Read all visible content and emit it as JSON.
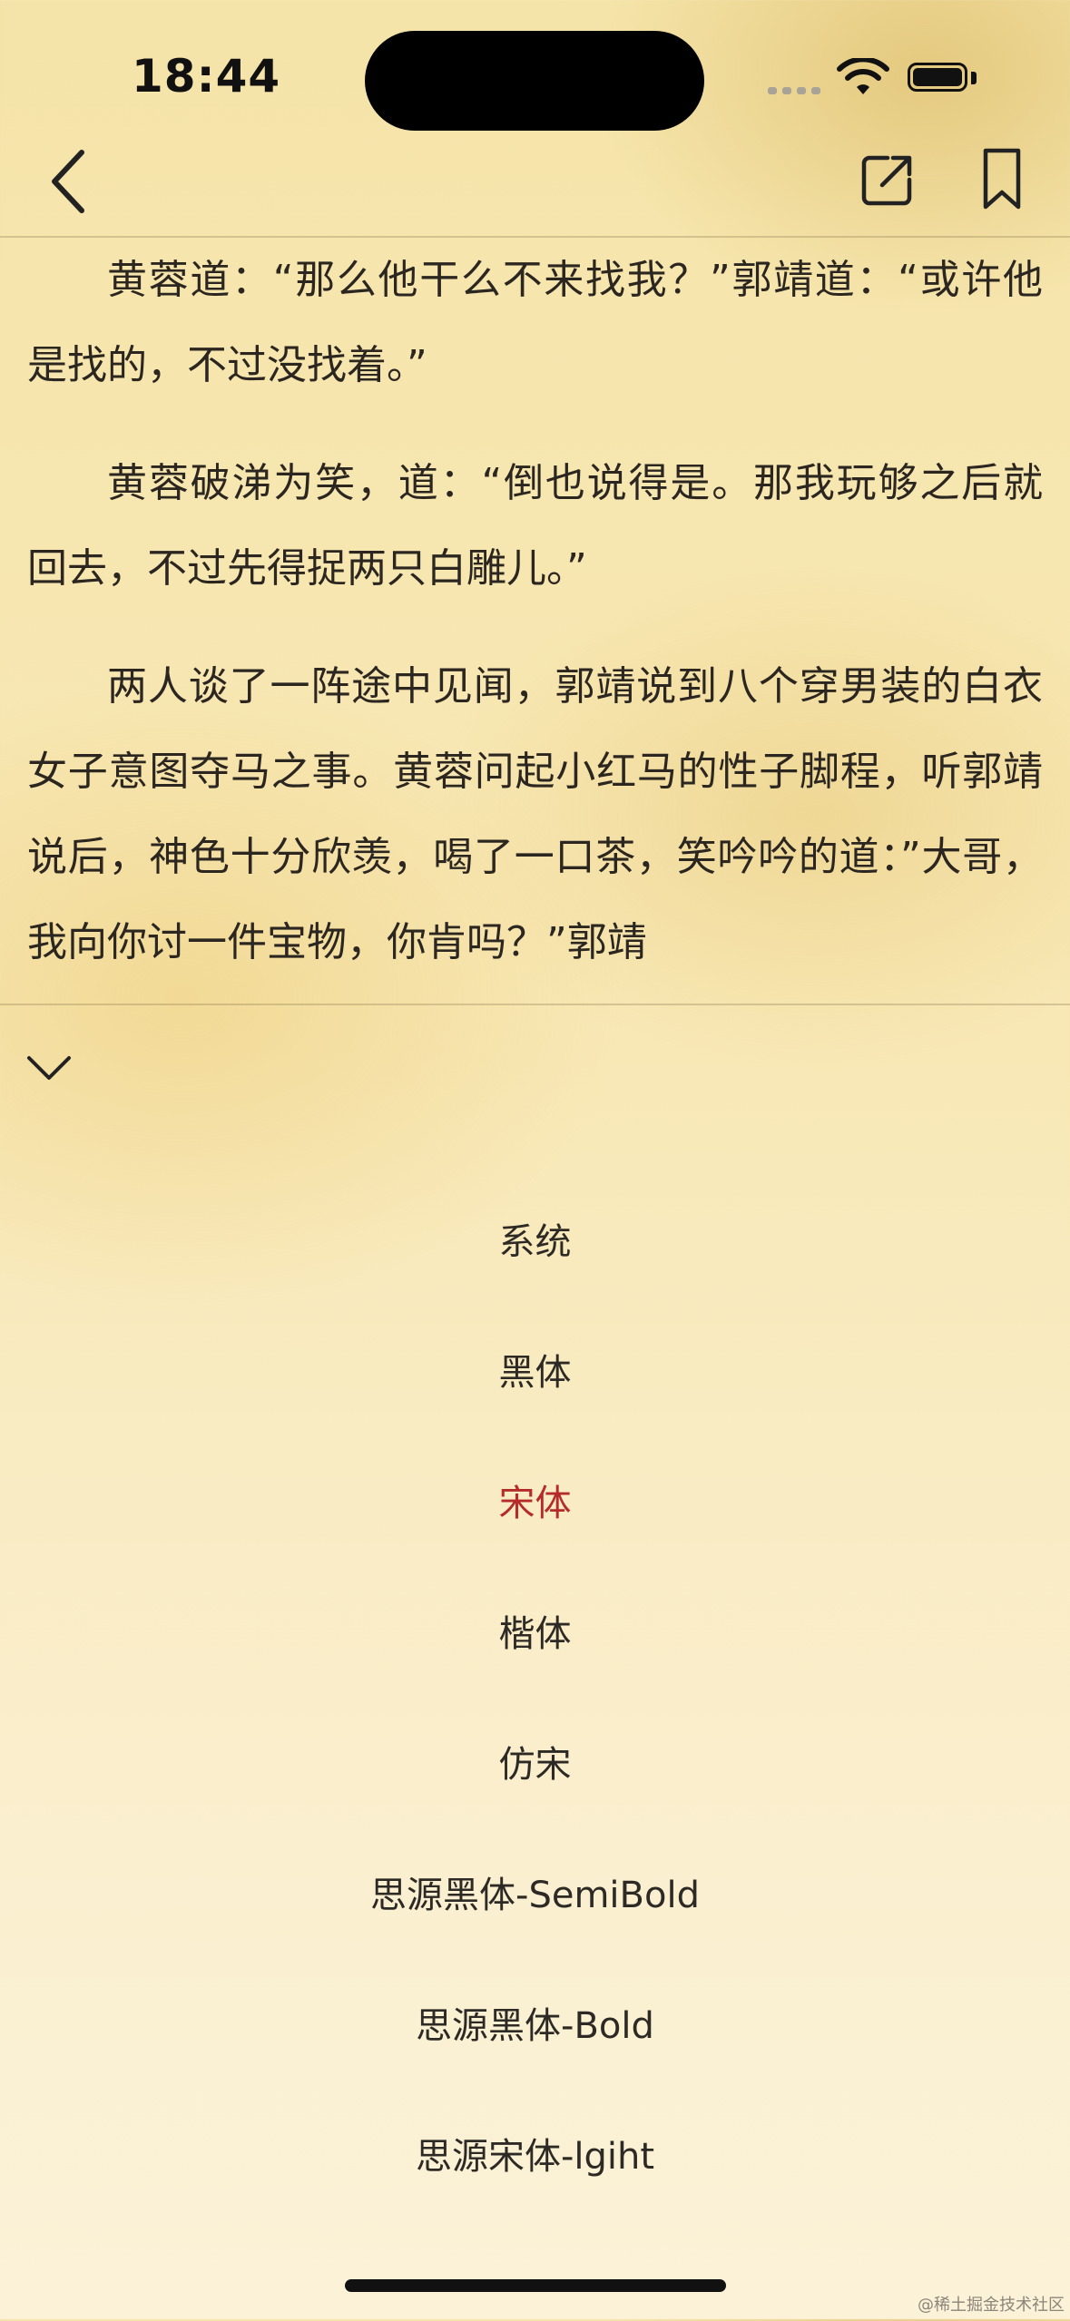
{
  "status_bar": {
    "time": "18:44",
    "wifi_icon": "wifi-icon",
    "battery_icon": "battery-icon"
  },
  "nav": {
    "back_icon": "chevron-left-icon",
    "share_icon": "share-icon",
    "bookmark_icon": "bookmark-icon"
  },
  "reader": {
    "paragraphs": [
      "黄蓉道：“那么他干么不来找我？”郭靖道：“或许他是找的，不过没找着。”",
      "黄蓉破涕为笑，道：“倒也说得是。那我玩够之后就回去，不过先得捉两只白雕儿。”",
      "两人谈了一阵途中见闻，郭靖说到八个穿男装的白衣女子意图夺马之事。黄蓉问起小红马的性子脚程，听郭靖说后，神色十分欣羡，喝了一口茶，笑吟吟的道：”大哥，我向你讨一件宝物，你肯吗？”郭靖"
    ]
  },
  "font_panel": {
    "collapse_icon": "chevron-down-icon",
    "selected_index": 2,
    "selected_color": "#b52a2a",
    "options": [
      "系统",
      "黑体",
      "宋体",
      "楷体",
      "仿宋",
      "思源黑体-SemiBold",
      "思源黑体-Bold",
      "思源宋体-lgiht"
    ]
  },
  "watermark": "@稀土掘金技术社区"
}
